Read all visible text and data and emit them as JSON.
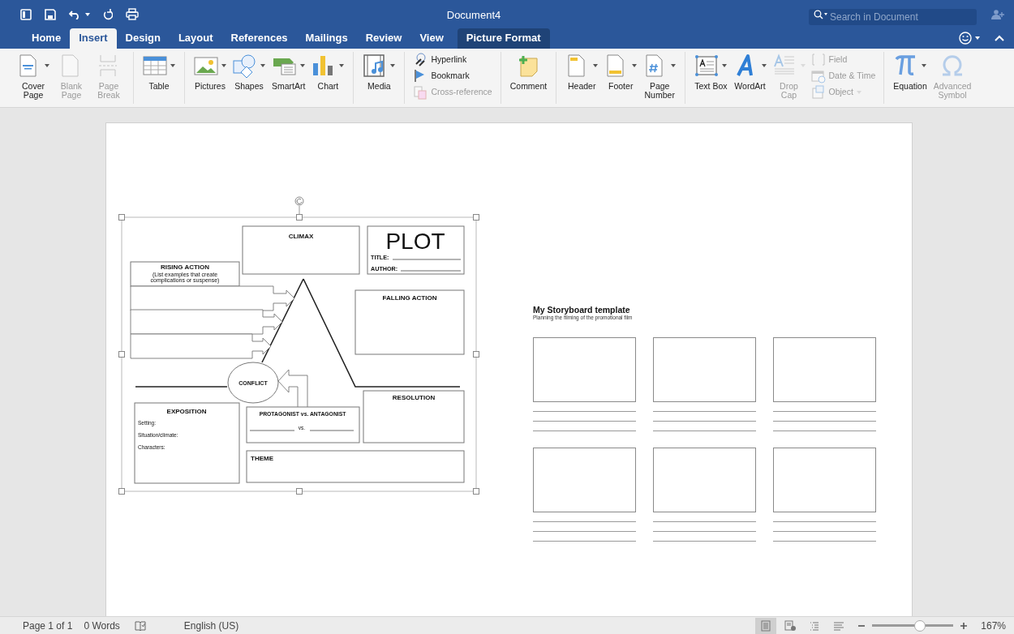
{
  "window": {
    "title": "Document4",
    "search": {
      "placeholder": "Search in Document"
    }
  },
  "tabs": [
    {
      "label": "Home",
      "selected": false,
      "kind": "normal"
    },
    {
      "label": "Insert",
      "selected": true,
      "kind": "normal"
    },
    {
      "label": "Design",
      "selected": false,
      "kind": "normal"
    },
    {
      "label": "Layout",
      "selected": false,
      "kind": "normal"
    },
    {
      "label": "References",
      "selected": false,
      "kind": "normal"
    },
    {
      "label": "Mailings",
      "selected": false,
      "kind": "normal"
    },
    {
      "label": "Review",
      "selected": false,
      "kind": "normal"
    },
    {
      "label": "View",
      "selected": false,
      "kind": "normal"
    },
    {
      "label": "Picture Format",
      "selected": false,
      "kind": "contextual"
    }
  ],
  "ribbon": {
    "groups": [
      {
        "buttons": [
          {
            "label": "Cover\nPage",
            "kind": "large",
            "dropdown": true,
            "disabled": false
          },
          {
            "label": "Blank\nPage",
            "kind": "large",
            "dropdown": false,
            "disabled": true
          },
          {
            "label": "Page\nBreak",
            "kind": "large",
            "dropdown": false,
            "disabled": true
          }
        ]
      },
      {
        "buttons": [
          {
            "label": "Table",
            "kind": "large",
            "dropdown": true,
            "disabled": false
          }
        ]
      },
      {
        "buttons": [
          {
            "label": "Pictures",
            "kind": "large",
            "dropdown": true,
            "disabled": false
          },
          {
            "label": "Shapes",
            "kind": "large",
            "dropdown": true,
            "disabled": false
          },
          {
            "label": "SmartArt",
            "kind": "large",
            "dropdown": true,
            "disabled": false
          },
          {
            "label": "Chart",
            "kind": "large",
            "dropdown": true,
            "disabled": false
          }
        ]
      },
      {
        "buttons": [
          {
            "label": "Media",
            "kind": "large",
            "dropdown": true,
            "disabled": false
          }
        ]
      },
      {
        "buttons": [
          {
            "label": "Hyperlink",
            "kind": "small",
            "dropdown": false,
            "disabled": false
          },
          {
            "label": "Bookmark",
            "kind": "small",
            "dropdown": false,
            "disabled": false
          },
          {
            "label": "Cross-reference",
            "kind": "small",
            "dropdown": false,
            "disabled": true
          }
        ]
      },
      {
        "buttons": [
          {
            "label": "Comment",
            "kind": "large",
            "dropdown": false,
            "disabled": false
          }
        ]
      },
      {
        "buttons": [
          {
            "label": "Header",
            "kind": "large",
            "dropdown": true,
            "disabled": false
          },
          {
            "label": "Footer",
            "kind": "large",
            "dropdown": true,
            "disabled": false
          },
          {
            "label": "Page\nNumber",
            "kind": "large",
            "dropdown": true,
            "disabled": false
          }
        ]
      },
      {
        "buttons": [
          {
            "label": "Text Box",
            "kind": "large",
            "dropdown": true,
            "disabled": false
          },
          {
            "label": "WordArt",
            "kind": "large",
            "dropdown": true,
            "disabled": false
          },
          {
            "label": "Drop\nCap",
            "kind": "large",
            "dropdown": true,
            "disabled": true
          },
          {
            "label": "Field",
            "kind": "small",
            "dropdown": false,
            "disabled": true
          },
          {
            "label": "Date & Time",
            "kind": "small",
            "dropdown": false,
            "disabled": true
          },
          {
            "label": "Object",
            "kind": "small",
            "dropdown": true,
            "disabled": true
          }
        ]
      },
      {
        "buttons": [
          {
            "label": "Equation",
            "kind": "large",
            "dropdown": true,
            "disabled": false
          },
          {
            "label": "Advanced\nSymbol",
            "kind": "large",
            "dropdown": false,
            "disabled": true
          }
        ]
      }
    ]
  },
  "document": {
    "plot_diagram": {
      "title": "PLOT",
      "title_field": "TITLE:",
      "author_field": "AUTHOR:",
      "climax": "CLIMAX",
      "rising_action": {
        "heading": "RISING ACTION",
        "note": "(List examples that create complications or suspense)"
      },
      "falling_action": "FALLING ACTION",
      "conflict": "CONFLICT",
      "resolution": "RESOLUTION",
      "exposition": {
        "heading": "EXPOSITION",
        "fields": [
          "Setting:",
          "Situation/climate:",
          "Characters:"
        ]
      },
      "protagonist_antagonist": {
        "heading": "PROTAGONIST vs. ANTAGONIST",
        "vs": "vs."
      },
      "theme": "THEME"
    },
    "storyboard": {
      "title": "My Storyboard template",
      "subtitle": "Planning the filming of the promotional film"
    }
  },
  "status_bar": {
    "page": "Page 1 of 1",
    "words": "0 Words",
    "language": "English (US)",
    "views": [
      {
        "selected": true
      },
      {
        "selected": false
      },
      {
        "selected": false
      },
      {
        "selected": false
      }
    ],
    "zoom": {
      "level": 0.59,
      "reading": "167%"
    }
  }
}
